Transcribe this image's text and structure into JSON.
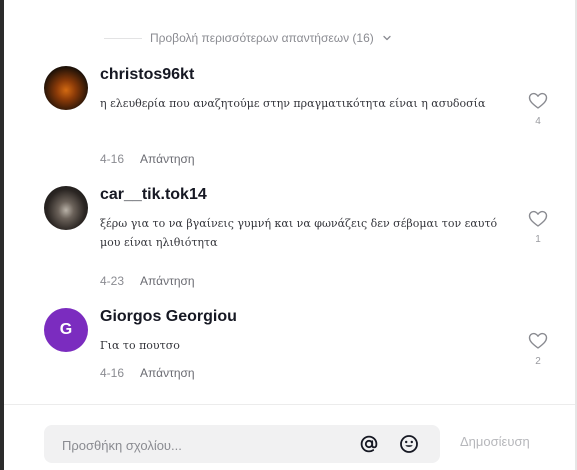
{
  "more_replies": {
    "label": "Προβολή περισσότερων απαντήσεων (16)"
  },
  "comments": [
    {
      "username": "christos96kt",
      "text": "η ελευθερία που αναζητούμε στην πραγματικότητα είναι η ασυδοσία",
      "date": "4-16",
      "reply_label": "Απάντηση",
      "likes": "4",
      "avatar_letter": ""
    },
    {
      "username": "car__tik.tok14",
      "text": "ξέρω για το να βγαίνεις γυμνή και να φωνάζεις δεν σέβομαι τον εαυτό μου είναι ηλιθιότητα",
      "date": "4-23",
      "reply_label": "Απάντηση",
      "likes": "1",
      "avatar_letter": ""
    },
    {
      "username": "Giorgos Georgiou",
      "text": "Για το πουτσο",
      "date": "4-16",
      "reply_label": "Απάντηση",
      "likes": "2",
      "avatar_letter": "G"
    }
  ],
  "composer": {
    "placeholder": "Προσθήκη σχολίου...",
    "post_label": "Δημοσίευση"
  },
  "colors": {
    "avatar_g": "#7b2cbf",
    "text_primary": "#161823",
    "text_secondary": "#8a8b91"
  },
  "icons": {
    "like": "heart-icon",
    "mention": "at-sign-icon",
    "emoji": "smile-icon",
    "expand": "chevron-down-icon"
  }
}
